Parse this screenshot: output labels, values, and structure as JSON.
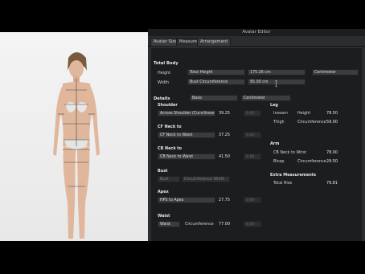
{
  "window_title": "Avatar Editor",
  "tabs": [
    {
      "label": "Avatar Size"
    },
    {
      "label": "Measure"
    },
    {
      "label": "Arrangement"
    }
  ],
  "total_body": {
    "header": "Total Body",
    "height_label": "Height",
    "height_select": "Total Height",
    "height_value": "175.26 cm",
    "unit_select": "Centimeter",
    "width_label": "Width",
    "width_select": "Bust Circumference",
    "width_value": "95.00 cm"
  },
  "details": {
    "header": "Details",
    "mode_select": "Basic",
    "unit_select": "Centimeter"
  },
  "left_sections": {
    "shoulder": {
      "title": "Shoulder",
      "field": "Across Shoulder (Curvilinear)",
      "value": "39.25",
      "ghost": "0.00"
    },
    "cf_neck": {
      "title": "CF Neck to",
      "field": "CF Neck to Waist",
      "value": "37.25",
      "ghost": "0.41"
    },
    "cb_neck": {
      "title": "CB Neck to",
      "field": "CB Neck to Waist",
      "value": "41.50",
      "ghost": "0.96"
    },
    "bust": {
      "title": "Bust",
      "field": "Bust",
      "dim_field": "Circumference Width"
    },
    "apex": {
      "title": "Apex",
      "field": "HPS to Apex",
      "value": "27.75",
      "ghost": "0.00"
    },
    "waist": {
      "title": "Waist",
      "field": "Waist",
      "sub": "Circumference",
      "value": "77.00",
      "ghost": "0.00"
    }
  },
  "right_sections": {
    "leg": {
      "title": "Leg",
      "inseam_label": "Inseam",
      "inseam_sub": "Height",
      "inseam_value": "78.50",
      "thigh_label": "Thigh",
      "thigh_sub": "Circumference",
      "thigh_value": "59.00"
    },
    "arm": {
      "title": "Arm",
      "cb_label": "CB Neck to Wrist",
      "cb_value": "78.00",
      "bicep_label": "Bicep",
      "bicep_sub": "Circumference",
      "bicep_value": "29.50"
    },
    "extra": {
      "title": "Extra Measurements",
      "rise_label": "Total Rise",
      "rise_value": "79.81"
    }
  },
  "colors": {
    "panel_bg": "#2c2d30",
    "viewport_bg": "#f0f0f0",
    "skin": "#e0b79d",
    "measure_lines": "#444444"
  }
}
